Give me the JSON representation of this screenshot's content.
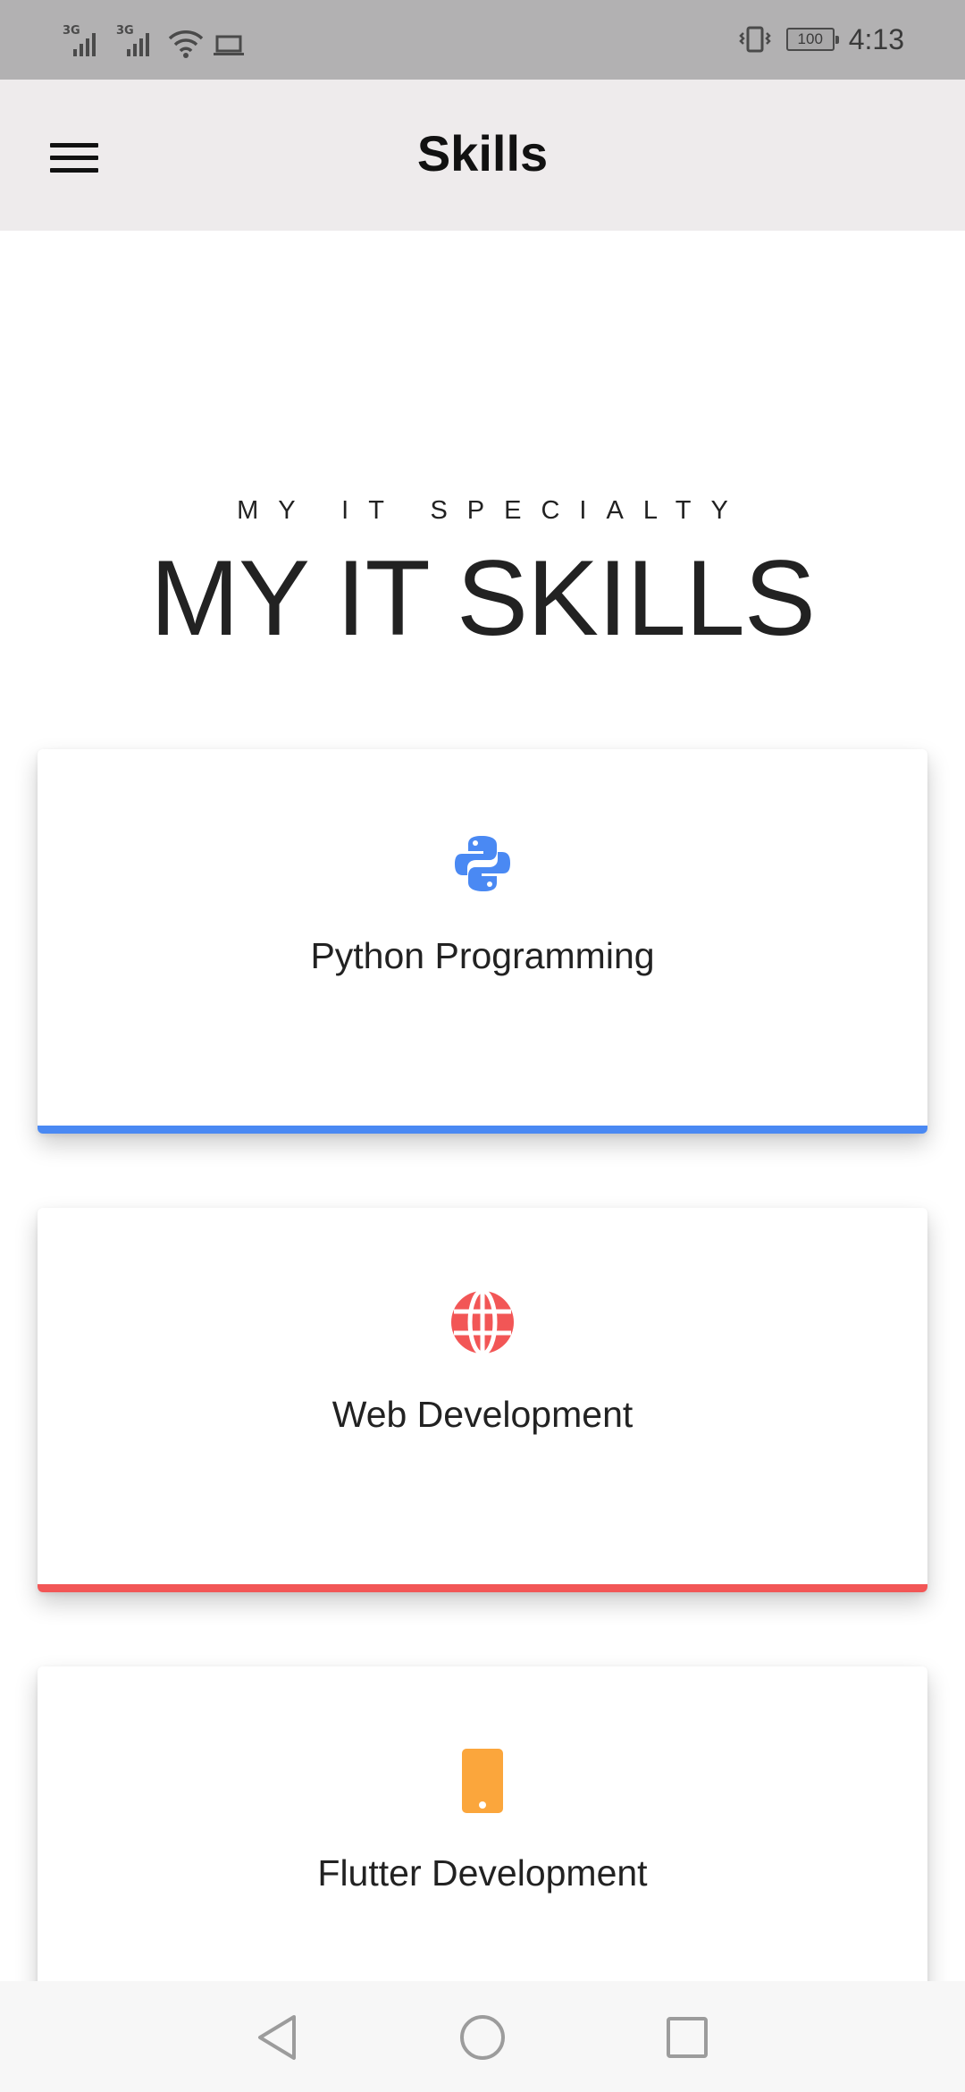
{
  "status_bar": {
    "network_1": "3G",
    "network_2": "3G",
    "battery": "100",
    "time": "4:13",
    "icons": [
      "signal-icon",
      "signal-icon",
      "wifi-icon",
      "laptop-icon",
      "vibrate-icon",
      "battery-icon"
    ]
  },
  "app_bar": {
    "title": "Skills",
    "menu_icon": "hamburger-menu-icon"
  },
  "header": {
    "subtitle": "MY IT SPECIALTY",
    "headline": "MY IT SKILLS"
  },
  "skills": [
    {
      "label": "Python Programming",
      "icon": "python-icon",
      "color": "#4a89f3"
    },
    {
      "label": "Web Development",
      "icon": "globe-icon",
      "color": "#f25656"
    },
    {
      "label": "Flutter Development",
      "icon": "phone-icon",
      "color": "#fba63c"
    }
  ],
  "nav_bar": {
    "icons": [
      "back-icon",
      "home-icon",
      "recents-icon"
    ]
  }
}
